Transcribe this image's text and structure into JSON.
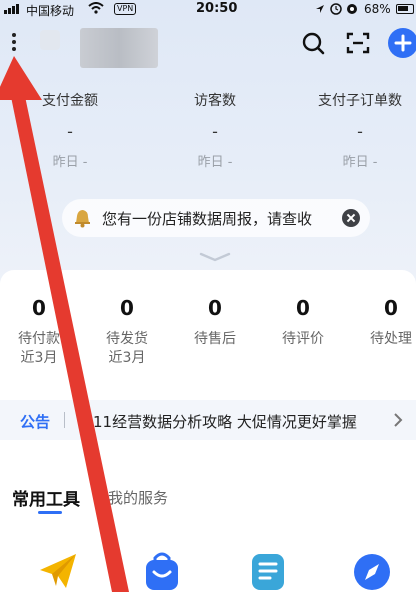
{
  "status_bar": {
    "carrier": "中国移动",
    "vpn": "VPN",
    "time": "20:50",
    "battery": "68%"
  },
  "header": {
    "menu_icon": "more-vert-icon",
    "search_icon": "search-icon",
    "scan_icon": "scan-icon",
    "add_icon": "plus-icon"
  },
  "stats": [
    {
      "label": "支付金额",
      "value": "-",
      "yesterday": "昨日 -"
    },
    {
      "label": "访客数",
      "value": "-",
      "yesterday": "昨日 -"
    },
    {
      "label": "支付子订单数",
      "value": "-",
      "yesterday": "昨日 -"
    }
  ],
  "notice": {
    "icon": "bell-icon",
    "text": "您有一份店铺数据周报，请查收",
    "close_icon": "close-icon"
  },
  "orders": [
    {
      "count": "0",
      "label_line1": "待付款",
      "label_line2": "近3月"
    },
    {
      "count": "0",
      "label_line1": "待发货",
      "label_line2": "近3月"
    },
    {
      "count": "0",
      "label_line1": "待售后",
      "label_line2": ""
    },
    {
      "count": "0",
      "label_line1": "待评价",
      "label_line2": ""
    },
    {
      "count": "0",
      "label_line1": "待处理",
      "label_line2": ""
    }
  ],
  "announcement": {
    "tag": "公告",
    "text": "双11经营数据分析攻略 大促情况更好掌握"
  },
  "tabs": [
    {
      "label": "常用工具",
      "active": true
    },
    {
      "label": "我的服务",
      "active": false
    }
  ],
  "tools": [
    {
      "icon": "paper-plane-icon",
      "color": "#f4b400"
    },
    {
      "icon": "shopping-bag-icon",
      "color": "#2f6ff5"
    },
    {
      "icon": "document-icon",
      "color": "#3aa6d9"
    },
    {
      "icon": "compass-icon",
      "color": "#2f6ff5"
    }
  ],
  "colors": {
    "accent": "#2f6ff5",
    "arrow": "#e53a2f"
  }
}
